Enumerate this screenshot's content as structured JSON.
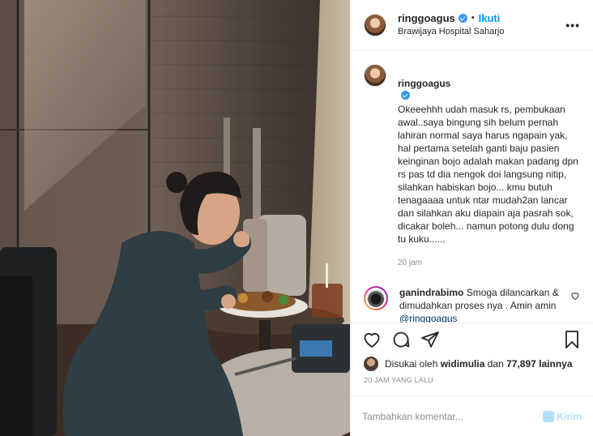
{
  "header": {
    "username": "ringgoagus",
    "dot": "•",
    "follow_label": "Ikuti",
    "location": "Brawijaya Hospital Saharjo",
    "more_label": "•••"
  },
  "caption": {
    "username": "ringgoagus",
    "text": "Okeeehhh udah masuk rs, pembukaan awal..saya bingung sih belum pernah lahiran normal saya harus ngapain yak, hal pertama setelah ganti baju pasien keinginan bojo adalah makan padang dpn rs pas td dia nengok doi langsung nitip, silahkan habiskan bojo... kmu butuh tenagaaaa untuk ntar mudah2an lancar dan silahkan aku diapain aja pasrah sok, dicakar boleh... namun potong dulu dong tu kuku......",
    "time": "20 jam"
  },
  "comment": {
    "username": "ganindrabimo",
    "text": "Smoga dilancarkan & dimudahkan proses nya . Amin amin",
    "mention": "@ringgoagus"
  },
  "likes": {
    "prefix": "Disukai oleh",
    "liker": "widimulia",
    "middle": "dan",
    "count": "77,897 lainnya"
  },
  "post_age": "20 JAM YANG LALU",
  "add_comment": {
    "placeholder": "Tambahkan komentar...",
    "send_label": "Kirim"
  },
  "icons": {
    "like": "heart-icon",
    "comment": "comment-icon",
    "share": "share-icon",
    "save": "bookmark-icon",
    "verified": "verified-badge-icon"
  },
  "colors": {
    "accent": "#0095f6",
    "verified": "#3897f0",
    "muted": "#8e8e8e",
    "send_disabled": "#b2dffc"
  }
}
